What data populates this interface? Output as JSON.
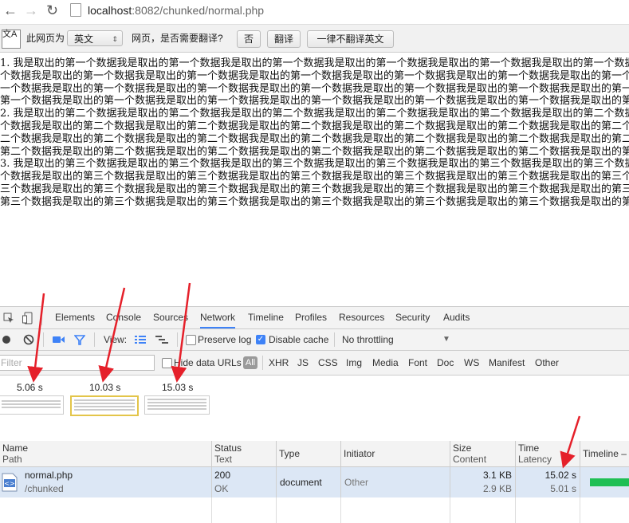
{
  "browser": {
    "back_icon": "←",
    "forward_icon": "→",
    "reload_icon": "↻",
    "url_host": "localhost",
    "url_rest": ":8082/chunked/normal.php"
  },
  "translate_bar": {
    "icon_label": "文A",
    "page_lang_label": "此网页为",
    "language": "英文",
    "question": "网页，是否需要翻译?",
    "no_button": "否",
    "translate_button": "翻译",
    "never_button": "一律不翻译英文"
  },
  "content": {
    "lines": [
      "1. 我是取出的第一个数据我是取出的第一个数据我是取出的第一个数据我是取出的第一个数据我是取出的第一个数据我是取出的第一个数据",
      "个数据我是取出的第一个数据我是取出的第一个数据我是取出的第一个数据我是取出的第一个数据我是取出的第一个数据我是取出的第一个数",
      "一个数据我是取出的第一个数据我是取出的第一个数据我是取出的第一个数据我是取出的第一个数据我是取出的第一个数据我是取出的第一个",
      "第一个数据我是取出的第一个数据我是取出的第一个数据我是取出的第一个数据我是取出的第一个数据我是取出的第一个数据我是取出的第一",
      "2. 我是取出的第二个数据我是取出的第二个数据我是取出的第二个数据我是取出的第二个数据我是取出的第二个数据我是取出的第二个数据",
      "个数据我是取出的第二个数据我是取出的第二个数据我是取出的第二个数据我是取出的第二个数据我是取出的第二个数据我是取出的第二个数",
      "二个数据我是取出的第二个数据我是取出的第二个数据我是取出的第二个数据我是取出的第二个数据我是取出的第二个数据我是取出的第二个",
      "第二个数据我是取出的第二个数据我是取出的第二个数据我是取出的第二个数据我是取出的第二个数据我是取出的第二个数据我是取出的第二",
      "3. 我是取出的第三个数据我是取出的第三个数据我是取出的第三个数据我是取出的第三个数据我是取出的第三个数据我是取出的第三个数据",
      "个数据我是取出的第三个数据我是取出的第三个数据我是取出的第三个数据我是取出的第三个数据我是取出的第三个数据我是取出的第三个数",
      "三个数据我是取出的第三个数据我是取出的第三个数据我是取出的第三个数据我是取出的第三个数据我是取出的第三个数据我是取出的第三个",
      "第三个数据我是取出的第三个数据我是取出的第三个数据我是取出的第三个数据我是取出的第三个数据我是取出的第三个数据我是取出的第三"
    ]
  },
  "devtools": {
    "tabs": [
      "Elements",
      "Console",
      "Sources",
      "Network",
      "Timeline",
      "Profiles",
      "Resources",
      "Security",
      "Audits"
    ],
    "active_tab": "Network",
    "toolbar": {
      "view_label": "View:",
      "preserve_log": "Preserve log",
      "preserve_log_checked": false,
      "disable_cache": "Disable cache",
      "disable_cache_checked": true,
      "throttling": "No throttling"
    },
    "filter": {
      "placeholder": "Filter",
      "hide_data_urls": "Hide data URLs",
      "all": "All",
      "types": [
        "XHR",
        "JS",
        "CSS",
        "Img",
        "Media",
        "Font",
        "Doc",
        "WS",
        "Manifest",
        "Other"
      ]
    },
    "filmstrip": {
      "times": [
        "5.06 s",
        "10.03 s",
        "15.03 s"
      ]
    },
    "columns": {
      "name": "Name",
      "path": "Path",
      "status": "Status",
      "text": "Text",
      "type": "Type",
      "initiator": "Initiator",
      "size": "Size",
      "content": "Content",
      "time": "Time",
      "latency": "Latency",
      "timeline": "Timeline – S"
    },
    "rows": [
      {
        "name": "normal.php",
        "path": "/chunked",
        "status": "200",
        "status_text": "OK",
        "type": "document",
        "initiator": "Other",
        "size": "3.1 KB",
        "content": "2.9 KB",
        "time": "15.02 s",
        "latency": "5.01 s"
      }
    ]
  },
  "colors": {
    "annotation_arrow": "#e5202a",
    "timeline_bar": "#1fbf54",
    "selected_row": "#dce7f5",
    "accent": "#3e82f7"
  }
}
